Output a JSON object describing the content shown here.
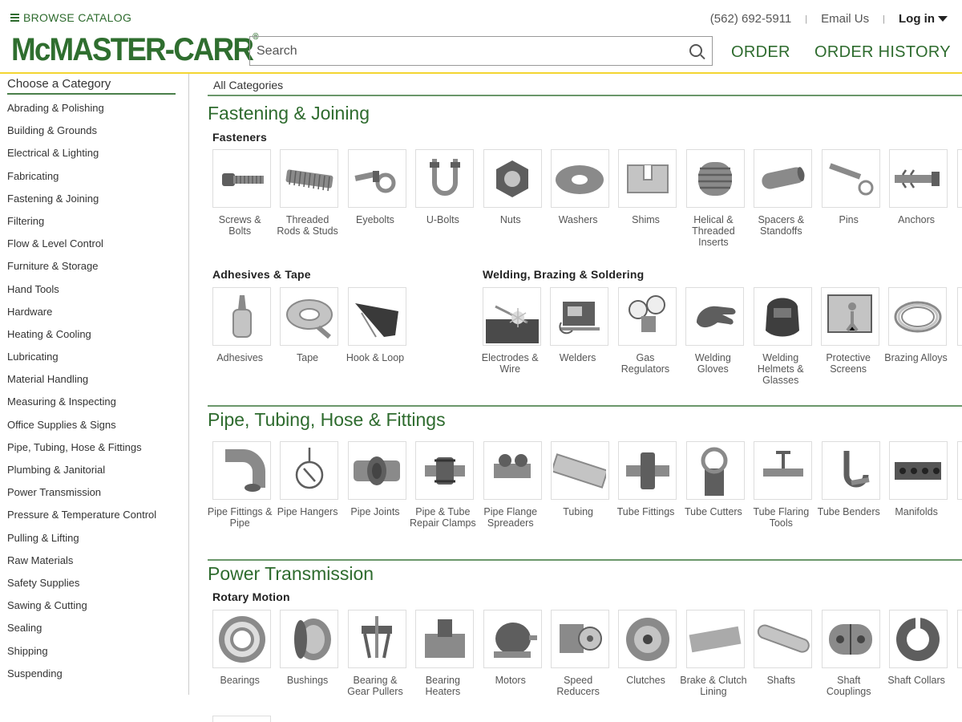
{
  "header": {
    "browse_label": "BROWSE CATALOG",
    "logo_text": "McMASTER-CARR",
    "logo_mark": "®",
    "phone": "(562) 692-5911",
    "email_label": "Email Us",
    "login_label": "Log in",
    "search_placeholder": "Search",
    "order_label": "ORDER",
    "order_history_label": "ORDER HISTORY",
    "accent_color": "#2e6b2e",
    "rule_color": "#f3d531"
  },
  "sidebar": {
    "title": "Choose a Category",
    "items": [
      "Abrading & Polishing",
      "Building & Grounds",
      "Electrical & Lighting",
      "Fabricating",
      "Fastening & Joining",
      "Filtering",
      "Flow & Level Control",
      "Furniture & Storage",
      "Hand Tools",
      "Hardware",
      "Heating & Cooling",
      "Lubricating",
      "Material Handling",
      "Measuring & Inspecting",
      "Office Supplies & Signs",
      "Pipe, Tubing, Hose & Fittings",
      "Plumbing & Janitorial",
      "Power Transmission",
      "Pressure & Temperature Control",
      "Pulling & Lifting",
      "Raw Materials",
      "Safety Supplies",
      "Sawing & Cutting",
      "Sealing",
      "Shipping",
      "Suspending"
    ]
  },
  "main": {
    "breadcrumb": "All Categories",
    "sections": [
      {
        "title": "Fastening & Joining",
        "groups": [
          {
            "title": "Fasteners",
            "items": [
              {
                "label": "Screws & Bolts",
                "icon": "screw-icon"
              },
              {
                "label": "Threaded Rods & Studs",
                "icon": "threaded-rod-icon"
              },
              {
                "label": "Eyebolts",
                "icon": "eyebolt-icon"
              },
              {
                "label": "U-Bolts",
                "icon": "u-bolt-icon"
              },
              {
                "label": "Nuts",
                "icon": "nut-icon"
              },
              {
                "label": "Washers",
                "icon": "washer-icon"
              },
              {
                "label": "Shims",
                "icon": "shim-icon"
              },
              {
                "label": "Helical & Threaded Inserts",
                "icon": "helical-insert-icon"
              },
              {
                "label": "Spacers & Standoffs",
                "icon": "spacer-icon"
              },
              {
                "label": "Pins",
                "icon": "pin-icon"
              },
              {
                "label": "Anchors",
                "icon": "anchor-icon"
              }
            ]
          },
          {
            "title": "Adhesives & Tape",
            "items": [
              {
                "label": "Adhesives",
                "icon": "adhesive-bottle-icon"
              },
              {
                "label": "Tape",
                "icon": "tape-roll-icon"
              },
              {
                "label": "Hook & Loop",
                "icon": "hook-loop-icon"
              }
            ]
          },
          {
            "title": "Welding, Brazing & Soldering",
            "items": [
              {
                "label": "Electrodes & Wire",
                "icon": "electrode-icon"
              },
              {
                "label": "Welders",
                "icon": "welder-icon"
              },
              {
                "label": "Gas Regulators",
                "icon": "gas-regulator-icon"
              },
              {
                "label": "Welding Gloves",
                "icon": "welding-glove-icon"
              },
              {
                "label": "Welding Helmets & Glasses",
                "icon": "welding-helmet-icon"
              },
              {
                "label": "Protective Screens",
                "icon": "protective-screen-icon"
              },
              {
                "label": "Brazing Alloys",
                "icon": "brazing-coil-icon"
              }
            ]
          }
        ]
      },
      {
        "title": "Pipe, Tubing, Hose & Fittings",
        "groups": [
          {
            "title": "",
            "items": [
              {
                "label": "Pipe Fittings & Pipe",
                "icon": "pipe-elbow-icon"
              },
              {
                "label": "Pipe Hangers",
                "icon": "pipe-hanger-icon"
              },
              {
                "label": "Pipe Joints",
                "icon": "pipe-joint-icon"
              },
              {
                "label": "Pipe & Tube Repair Clamps",
                "icon": "repair-clamp-icon"
              },
              {
                "label": "Pipe Flange Spreaders",
                "icon": "flange-spreader-icon"
              },
              {
                "label": "Tubing",
                "icon": "tubing-icon"
              },
              {
                "label": "Tube Fittings",
                "icon": "tube-fitting-icon"
              },
              {
                "label": "Tube Cutters",
                "icon": "tube-cutter-icon"
              },
              {
                "label": "Tube Flaring Tools",
                "icon": "flaring-tool-icon"
              },
              {
                "label": "Tube Benders",
                "icon": "tube-bender-icon"
              },
              {
                "label": "Manifolds",
                "icon": "manifold-icon"
              }
            ]
          }
        ]
      },
      {
        "title": "Power Transmission",
        "groups": [
          {
            "title": "Rotary Motion",
            "items": [
              {
                "label": "Bearings",
                "icon": "bearing-icon"
              },
              {
                "label": "Bushings",
                "icon": "bushing-icon"
              },
              {
                "label": "Bearing & Gear Pullers",
                "icon": "puller-icon"
              },
              {
                "label": "Bearing Heaters",
                "icon": "bearing-heater-icon"
              },
              {
                "label": "Motors",
                "icon": "motor-icon"
              },
              {
                "label": "Speed Reducers",
                "icon": "speed-reducer-icon"
              },
              {
                "label": "Clutches",
                "icon": "clutch-icon"
              },
              {
                "label": "Brake & Clutch Lining",
                "icon": "brake-lining-icon"
              },
              {
                "label": "Shafts",
                "icon": "shaft-icon"
              },
              {
                "label": "Shaft Couplings",
                "icon": "shaft-coupling-icon"
              },
              {
                "label": "Shaft Collars",
                "icon": "shaft-collar-icon"
              }
            ]
          }
        ]
      }
    ]
  }
}
